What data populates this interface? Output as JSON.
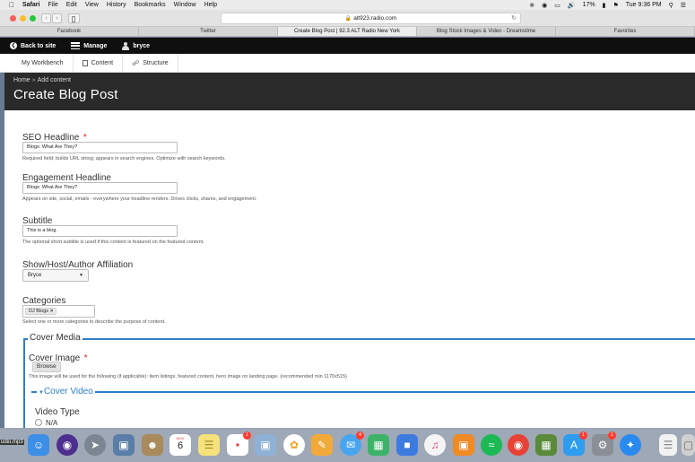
{
  "menubar": {
    "app": "Safari",
    "items": [
      "File",
      "Edit",
      "View",
      "History",
      "Bookmarks",
      "Window",
      "Help"
    ],
    "battery": "17%",
    "clock": "Tue 9:36 PM"
  },
  "browser": {
    "url": "alt923.radio.com",
    "tabs": [
      {
        "label": "Facebook",
        "active": false
      },
      {
        "label": "Twitter",
        "active": false
      },
      {
        "label": "Create Blog Post | 92.3 ALT Radio New York",
        "active": true
      },
      {
        "label": "Blog Stock Images & Video - Dreamstime",
        "active": false
      },
      {
        "label": "Favorites",
        "active": false
      }
    ]
  },
  "admin_bar": {
    "back": "Back to site",
    "manage": "Manage",
    "user": "bryce"
  },
  "tray": {
    "workbench": "My Workbench",
    "content": "Content",
    "structure": "Structure"
  },
  "page": {
    "breadcrumb_home": "Home",
    "breadcrumb_sep": "»",
    "breadcrumb_current": "Add content",
    "title": "Create Blog Post"
  },
  "form": {
    "seo": {
      "label": "SEO Headline",
      "required_mark": "*",
      "value": "Blogs: What Are They?",
      "description": "Required field; builds URL string; appears in search engines. Optimize with search keywords."
    },
    "engagement": {
      "label": "Engagement Headline",
      "value": "Blogs: What Are They?",
      "description": "Appears on site, social, emails - everywhere your headline renders. Drives clicks, shares, and engagement."
    },
    "subtitle": {
      "label": "Subtitle",
      "value": "This is a blog.",
      "description": "The optional short subtitle is used if this content is featured on the featured content."
    },
    "affiliation": {
      "label": "Show/Host/Author Affiliation",
      "selected": "Bryce"
    },
    "categories": {
      "label": "Categories",
      "tag": "DJ Blogs",
      "tag_remove": "×",
      "description": "Select one or more categories to describe the purpose of content."
    },
    "cover_media": {
      "legend": "Cover Media",
      "image_label": "Cover Image",
      "required_mark": "*",
      "browse": "Browse",
      "image_description": "This image will be used for the following (if applicable): item listings, featured content, hero image on landing page. (recommended min 1170x515)"
    },
    "cover_video": {
      "legend": "Cover Video",
      "video_type_label": "Video Type",
      "option_na": "N/A"
    }
  },
  "dock": {
    "left_label": "udio.mp3",
    "calendar_month": "NOV",
    "calendar_day": "6",
    "badge_reminders": "1",
    "badge_messages": "4",
    "badge_appstore": "1",
    "badge_prefs": "1"
  }
}
